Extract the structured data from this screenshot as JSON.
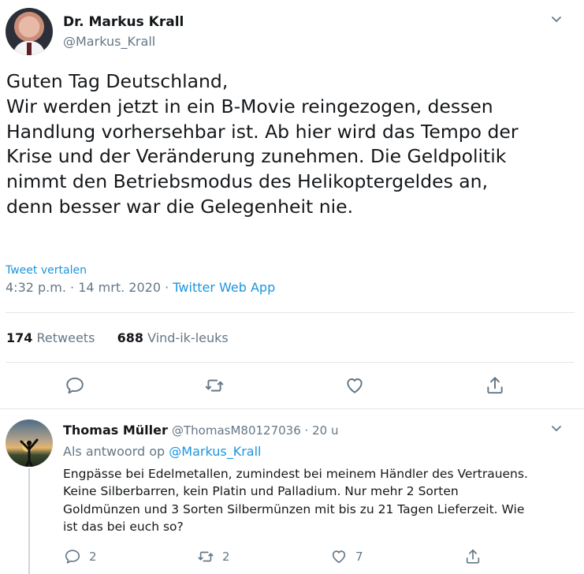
{
  "tweet": {
    "author_name": "Dr. Markus Krall",
    "author_handle": "@Markus_Krall",
    "text_lines": [
      "Guten Tag Deutschland,",
      "Wir werden jetzt in ein B-Movie reingezogen, dessen",
      "Handlung vorhersehbar ist. Ab hier wird das Tempo der",
      "Krise und der Veränderung zunehmen. Die Geldpolitik",
      "nimmt den Betriebsmodus des Helikoptergeldes an,",
      "denn besser war die Gelegenheit nie."
    ],
    "translate_label": "Tweet vertalen",
    "time": "4:32 p.m.",
    "sep1": "·",
    "date": "14 mrt. 2020",
    "sep2": "·",
    "source": "Twitter Web App",
    "retweet_count": "174",
    "retweet_label": "Retweets",
    "like_count": "688",
    "like_label": "Vind-ik-leuks"
  },
  "reply": {
    "author_name": "Thomas Müller",
    "author_handle": "@ThomasM80127036",
    "sep": "·",
    "age": "20 u",
    "reply_prefix": "Als antwoord op",
    "reply_to": "@Markus_Krall",
    "text_lines": [
      "Engpässe bei Edelmetallen, zumindest bei meinem Händler des Vertrauens.",
      "Keine Silberbarren, kein Platin und Palladium. Nur mehr 2 Sorten",
      "Goldmünzen und 3 Sorten Silbermünzen mit bis zu 21 Tagen Lieferzeit. Wie",
      "ist das bei euch so?"
    ],
    "reply_count": "2",
    "retweet_count": "2",
    "like_count": "7"
  },
  "icons": {
    "chevron": "chevron-down-icon",
    "reply": "reply-icon",
    "retweet": "retweet-icon",
    "like": "heart-icon",
    "share": "share-icon"
  },
  "colors": {
    "link": "#1b95e0",
    "secondary": "#657786",
    "text": "#14171a",
    "divider": "#e1e8ed"
  }
}
